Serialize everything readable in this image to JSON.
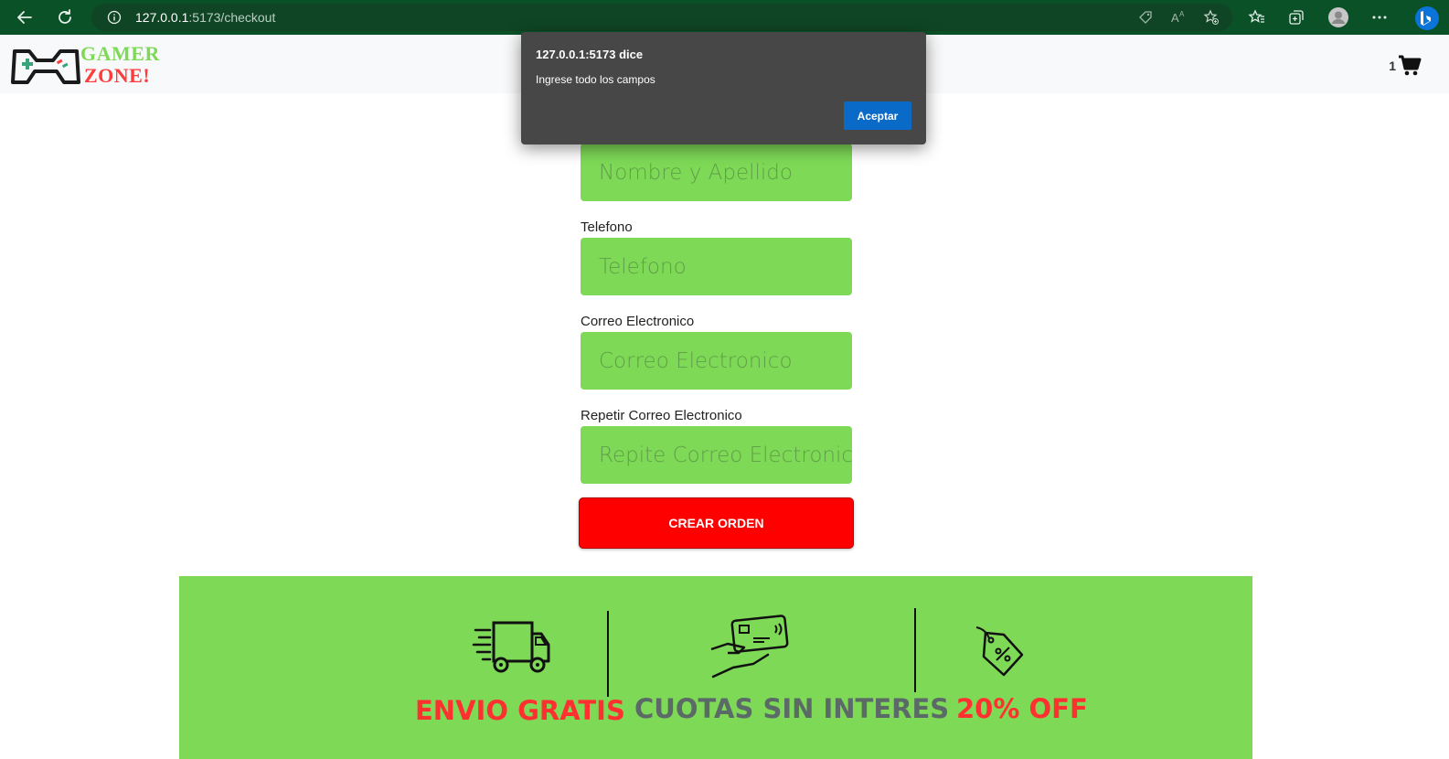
{
  "browser": {
    "url_host": "127.0.0.1",
    "url_path": ":5173/checkout",
    "icons": [
      "back-icon",
      "refresh-icon",
      "info-icon",
      "tag-icon",
      "read-aloud-icon",
      "favorite-add-icon",
      "favorites-icon",
      "collections-icon",
      "profile-icon",
      "more-icon",
      "bing-icon"
    ]
  },
  "site": {
    "logo_line1": "GAMER",
    "logo_line2": "ZONE!",
    "cart_count": "1"
  },
  "form": {
    "name_placeholder": "Nombre y Apellido",
    "phone_label": "Telefono",
    "phone_placeholder": "Telefono",
    "email_label": "Correo Electronico",
    "email_placeholder": "Correo Electronico",
    "repeat_email_label": "Repetir Correo Electronico",
    "repeat_email_placeholder": "Repite Correo Electronico",
    "submit_label": "CREAR ORDEN"
  },
  "alert": {
    "title": "127.0.0.1:5173 dice",
    "message": "Ingrese todo los campos",
    "ok_label": "Aceptar"
  },
  "benefits": [
    {
      "label": "ENVIO GRATIS",
      "icon": "truck-icon"
    },
    {
      "label": "CUOTAS SIN INTERES",
      "icon": "card-payment-icon"
    },
    {
      "label": "20% OFF",
      "icon": "discount-tag-icon"
    }
  ],
  "colors": {
    "browser_bar": "#0b5128",
    "accent_green": "#7ed957",
    "accent_red": "#ff0000",
    "alert_bg": "#474747",
    "alert_button": "#0a6ac7"
  }
}
